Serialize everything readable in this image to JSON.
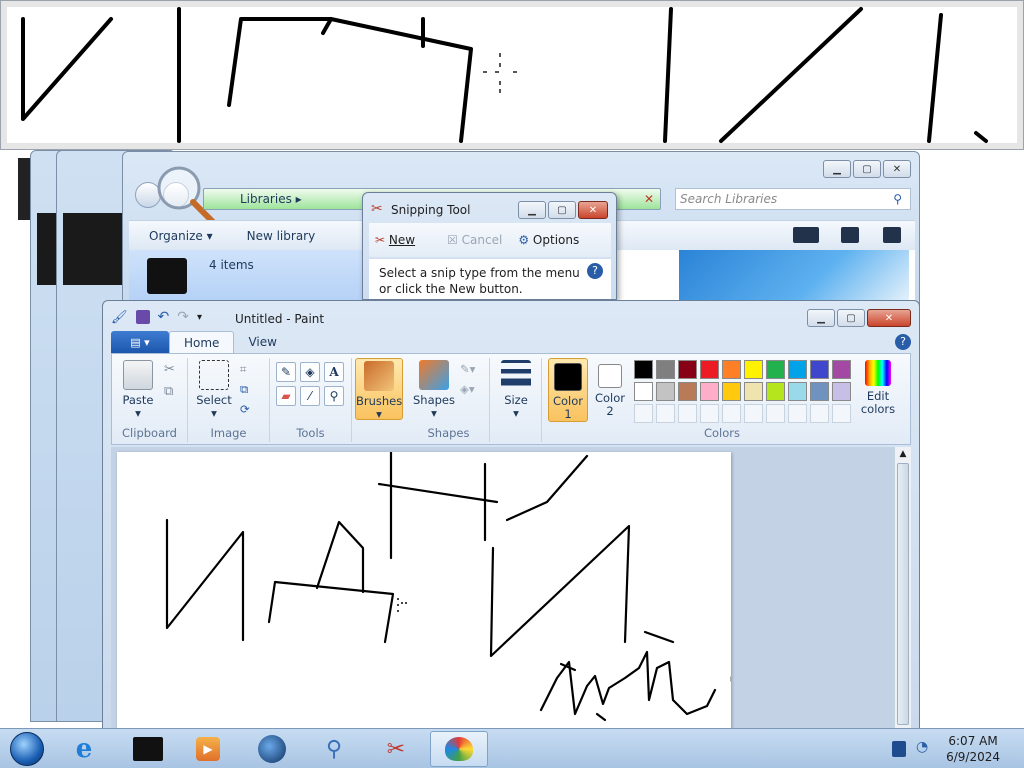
{
  "explorer": {
    "breadcrumb": "Libraries",
    "search_placeholder": "Search Libraries",
    "organize_label": "Organize ▾",
    "new_library_label": "New library",
    "items_count": "4 items"
  },
  "snipping_tool": {
    "title": "Snipping Tool",
    "new_label": "New",
    "cancel_label": "Cancel",
    "options_label": "Options",
    "message_line1": "Select a snip type from the menu",
    "message_line2": "or click the New button."
  },
  "paint": {
    "title": "Untitled - Paint",
    "tabs": [
      "Home",
      "View"
    ],
    "groups": {
      "clipboard": "Clipboard",
      "image": "Image",
      "tools": "Tools",
      "shapes": "Shapes",
      "colors": "Colors"
    },
    "buttons": {
      "paste": "Paste",
      "select": "Select",
      "brushes": "Brushes",
      "shapes": "Shapes",
      "size": "Size",
      "color1_line1": "Color",
      "color1_line2": "1",
      "color2_line1": "Color",
      "color2_line2": "2",
      "edit_colors_line1": "Edit",
      "edit_colors_line2": "colors"
    },
    "palette_row1": [
      "#000000",
      "#7f7f7f",
      "#880015",
      "#ed1c24",
      "#ff7f27",
      "#fff200",
      "#22b14c",
      "#00a2e8",
      "#3f48cc",
      "#a349a4"
    ],
    "palette_row2": [
      "#ffffff",
      "#c3c3c3",
      "#b97a57",
      "#ffaec9",
      "#ffc90e",
      "#efe4b0",
      "#b5e61d",
      "#99d9ea",
      "#7092be",
      "#c8bfe7"
    ],
    "color1": "#000000",
    "color2": "#ffffff"
  },
  "taskbar": {
    "time": "6:07 AM",
    "date": "6/9/2024",
    "apps": [
      "start-orb",
      "internet-explorer",
      "libraries",
      "media-player",
      "globe",
      "network",
      "snipping-tool",
      "paint"
    ]
  }
}
